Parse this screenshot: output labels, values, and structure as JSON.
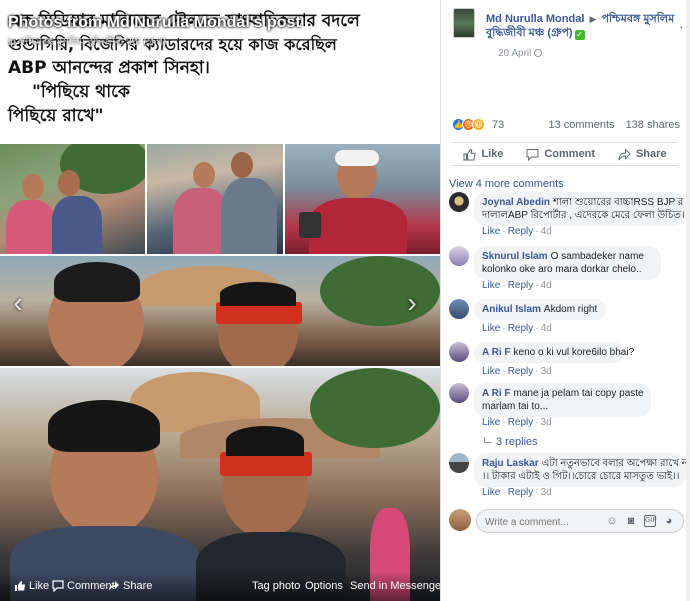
{
  "viewer": {
    "overlay_title": "Photos from Md Nurulla Mondal's post",
    "overlay_sub": "in পশ্চিমবঙ্গ মুসলিম বুদ্ধিজীবী মঞ্চ (গ্রুপ)",
    "headline": {
      "line1": "এক মিডিয়ার মালিকের দৌলতে সাংবাদিকতার বদলে",
      "line2": "গুন্ডাগিরি, বিজেপির ক্যাডারদের হয়ে কাজ করেছিল",
      "line3": "ABP আনন্দের প্রকাশ সিনহা।",
      "line4": "\"পিছিয়ে থাকে",
      "line5": "পিছিয়ে রাখে\""
    },
    "prev_arrow": "‹",
    "next_arrow": "›",
    "bottom_bar": {
      "like": "Like",
      "comment": "Comment",
      "share": "Share",
      "tag_photo": "Tag photo",
      "options": "Options",
      "send": "Send in Messenger"
    }
  },
  "post": {
    "author": "Md Nurulla Mondal",
    "group_line1": "পশ্চিমবঙ্গ মুসলিম",
    "group_line2": "বুদ্ধিজীবী মঞ্চ (গ্রুপ)",
    "date": "20 April",
    "menu": "···",
    "reaction_count": "73",
    "comments_count": "13 comments",
    "shares_count": "138 shares",
    "actions": {
      "like": "Like",
      "comment": "Comment",
      "share": "Share"
    },
    "reaction_colors": {
      "like": "#1877f2",
      "angry": "#e9710f",
      "haha": "#f7b125"
    }
  },
  "comments": {
    "view_more": "View 4 more comments",
    "items": [
      {
        "name": "Joynal Abedin",
        "text1": "শালা শুয়োরের বাচ্চাRSS BJP র",
        "text2": "দালালABP রিপোর্টার , এদেরকে মেরে ফেলা উচিত।",
        "like": "Like",
        "reply": "Reply",
        "time": "4d"
      },
      {
        "name": "Sknurul Islam",
        "text1": "O sambadeker name",
        "text2": "kolonko oke aro mara dorkar chelo..",
        "like": "Like",
        "reply": "Reply",
        "time": "4d"
      },
      {
        "name": "Anikul Islam",
        "text1": "Akdom right",
        "text2": "",
        "like": "Like",
        "reply": "Reply",
        "time": "4d"
      },
      {
        "name": "A Ri F",
        "text1": "keno o ki vul kore6ilo bhai?",
        "text2": "",
        "like": "Like",
        "reply": "Reply",
        "time": "3d"
      },
      {
        "name": "A Ri F",
        "text1": "mane ja pelam tai copy paste",
        "text2": "marlam tai to...",
        "like": "Like",
        "reply": "Reply",
        "time": "3d"
      },
      {
        "name": "Raju Laskar",
        "text1": "এটা নতুনভাবে বলার অপেক্ষা রাখে না",
        "text2": "।। টাকার এটাই ও গিট।।চোরে চোরে মাসতুত ভাই।।",
        "like": "Like",
        "reply": "Reply",
        "time": "3d"
      }
    ],
    "replies": "3 replies",
    "write_placeholder": "Write a comment..."
  }
}
